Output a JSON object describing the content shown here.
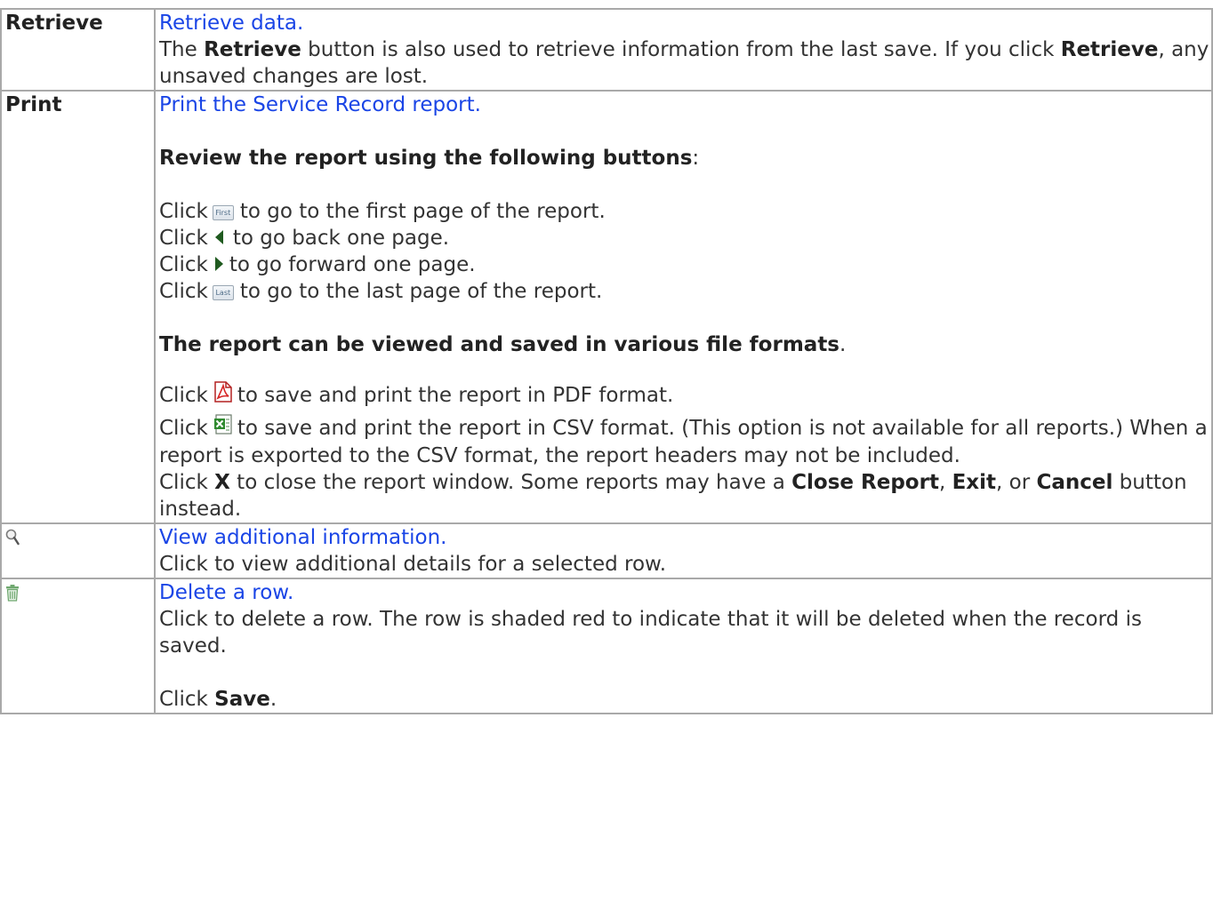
{
  "rows": {
    "retrieve": {
      "label": "Retrieve",
      "link": "Retrieve data.",
      "t1": "The ",
      "b1": "Retrieve",
      "t2": " button is also used to retrieve information from the last save. If you click ",
      "b2": "Retrieve",
      "t3": ", any unsaved changes are lost."
    },
    "print": {
      "label": "Print",
      "link": "Print the Service Record report.",
      "review_heading": "Review the report using the following buttons",
      "review_colon": ":",
      "click": "Click",
      "first_btn": "First",
      "last_btn": "Last",
      "first_text": "to go to the first page of the report.",
      "back_text": "to go back one page.",
      "forward_text": "to go forward one page.",
      "last_text": "to go to the last page of the report.",
      "formats_heading": "The report can be viewed and saved in various file formats",
      "formats_period": ".",
      "pdf_text": "to save and print the report in PDF format.",
      "csv_text": "to save and print the report in CSV format. (This option is not available for all reports.) When a report is exported to the CSV format, the report headers may not be included.",
      "close_t1": "Click ",
      "close_x": "X",
      "close_t2": " to close the report window. Some reports may have a ",
      "close_b1": "Close Report",
      "close_t3": ", ",
      "close_b2": "Exit",
      "close_t4": ", or ",
      "close_b3": "Cancel",
      "close_t5": " button instead."
    },
    "view": {
      "icon": "magnifier-icon",
      "link": "View additional information.",
      "text": "Click to view additional details for a selected row."
    },
    "delete": {
      "icon": "trash-icon",
      "link": "Delete a row.",
      "text": "Click to delete a row. The row is shaded red to indicate that it will be deleted when the record is saved.",
      "save_t1": "Click ",
      "save_b": "Save",
      "save_t2": "."
    }
  },
  "colors": {
    "link": "#1a45e6",
    "border": "#a9a9a9",
    "text": "#333333"
  }
}
